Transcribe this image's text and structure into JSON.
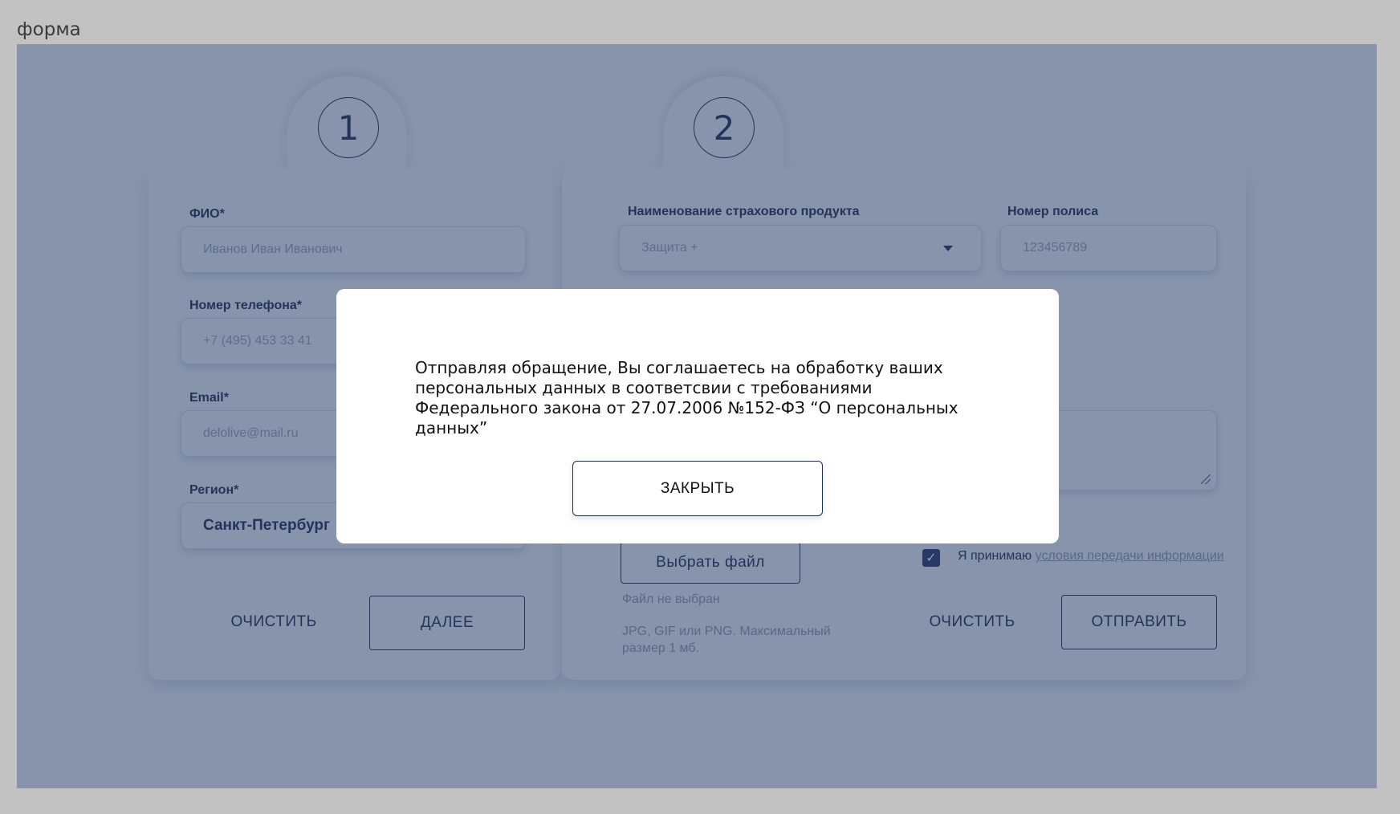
{
  "frame_label": "форма",
  "steps": [
    "1",
    "2"
  ],
  "step1": {
    "fio_label": "ФИО*",
    "fio_placeholder": "Иванов Иван Иванович",
    "phone_label": "Номер телефона*",
    "phone_placeholder": "+7 (495) 453 33 41",
    "email_label": "Email*",
    "email_placeholder": "delolive@mail.ru",
    "region_label": "Регион*",
    "region_value": "Санкт-Петербург",
    "clear_label": "ОЧИСТИТЬ",
    "next_label": "ДАЛЕЕ"
  },
  "step2": {
    "product_label": "Наименование страхового продукта",
    "product_value": "Защита +",
    "policy_label": "Номер полиса",
    "policy_placeholder": "123456789",
    "file_button_label": "Выбрать файл",
    "file_status": "Файл не выбран",
    "file_hint": "JPG, GIF или PNG. Максимальный размер 1 мб.",
    "consent_text": "Я принимаю",
    "consent_link": "условия передачи информации",
    "consent_checked": true,
    "clear_label": "ОЧИСТИТЬ",
    "submit_label": "ОТПРАВИТЬ"
  },
  "modal": {
    "message": "Отправляя обращение, Вы соглашаетесь на обработку ваших персональных данных в соответсвии с требованиями Федерального закона от 27.07.2006 №152-ФЗ “О персональных данных”",
    "close_label": "ЗАКРЫТЬ"
  },
  "colors": {
    "primary": "#233055",
    "background": "#eef1f7",
    "overlay": "#21375f",
    "page": "#c2c2c2"
  },
  "icons": {
    "dropdown": "chevron-down-icon",
    "checkbox": "checkmark-icon",
    "resize": "resize-handle-icon"
  }
}
